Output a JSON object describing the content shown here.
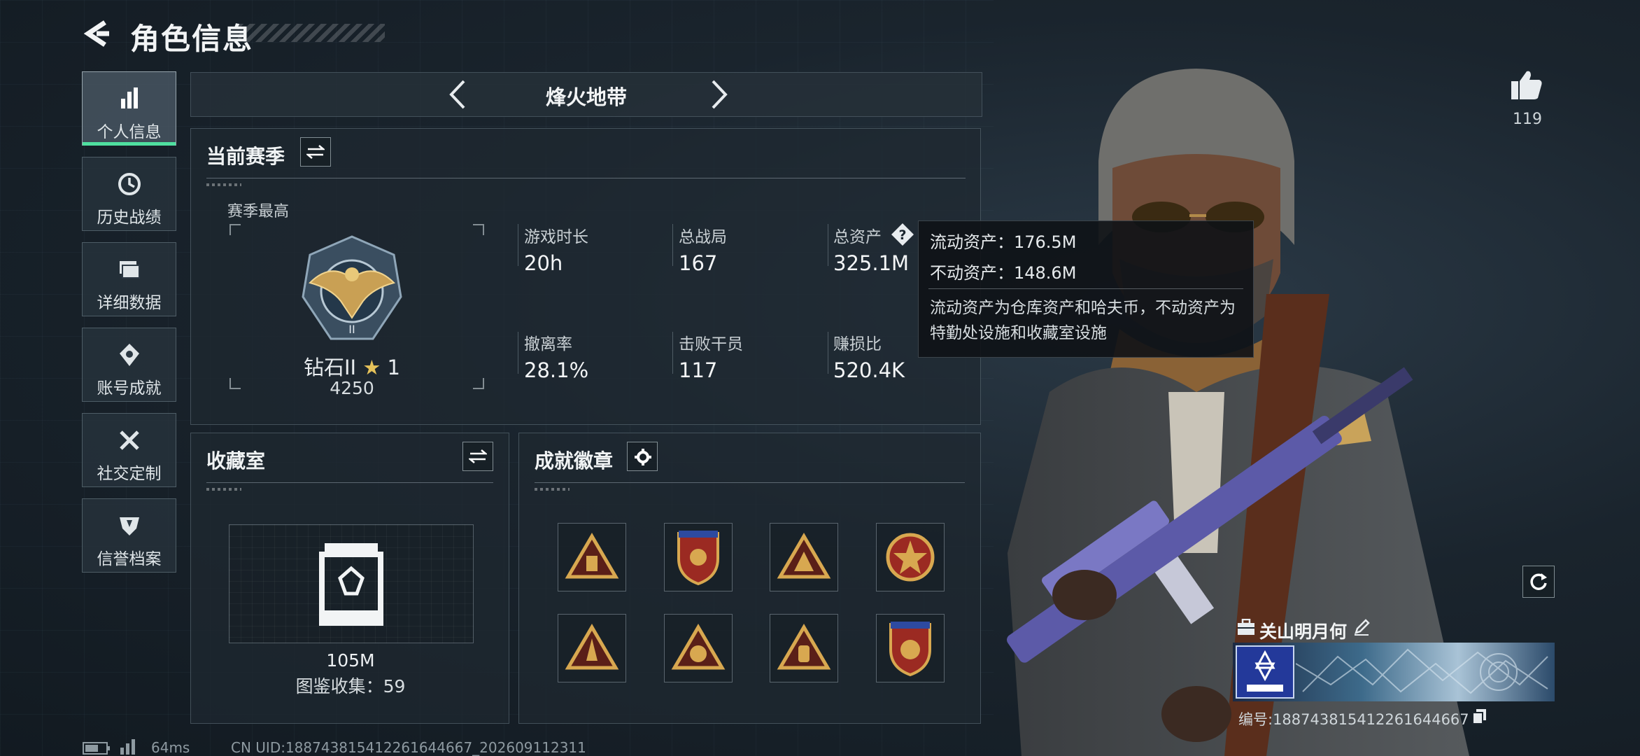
{
  "header": {
    "title": "角色信息"
  },
  "sidebar": {
    "items": [
      {
        "label": "个人信息",
        "icon": "bar-chart-icon",
        "active": true
      },
      {
        "label": "历史战绩",
        "icon": "history-icon",
        "active": false
      },
      {
        "label": "详细数据",
        "icon": "folder-icon",
        "active": false
      },
      {
        "label": "账号成就",
        "icon": "achievement-icon",
        "active": false
      },
      {
        "label": "社交定制",
        "icon": "tools-icon",
        "active": false
      },
      {
        "label": "信誉档案",
        "icon": "shield-icon",
        "active": false
      }
    ]
  },
  "mode": {
    "name": "烽火地带"
  },
  "season": {
    "title": "当前赛季",
    "best_label": "赛季最高",
    "rank_name": "钻石II",
    "rank_stars": "1",
    "rank_score": "4250",
    "stats": [
      {
        "label": "游戏时长",
        "value": "20h"
      },
      {
        "label": "总战局",
        "value": "167"
      },
      {
        "label": "总资产",
        "value": "325.1M"
      },
      {
        "label": "撤离率",
        "value": "28.1%"
      },
      {
        "label": "击败干员",
        "value": "117"
      },
      {
        "label": "赚损比",
        "value": "520.4K"
      }
    ]
  },
  "tooltip": {
    "liquid": "流动资产：176.5M",
    "fixed": "不动资产：148.6M",
    "note": "流动资产为仓库资产和哈夫币，不动资产为特勤处设施和收藏室设施"
  },
  "collection": {
    "title": "收藏室",
    "value": "105M",
    "catalog": "图鉴收集：59"
  },
  "achievements": {
    "title": "成就徽章",
    "badges": [
      "triangle-badge",
      "shield-badge",
      "triangle-badge",
      "star-badge",
      "triangle-badge",
      "triangle-badge",
      "triangle-badge",
      "shield-badge"
    ]
  },
  "profile": {
    "likes": "119",
    "name": "关山明月何",
    "id_text": "编号:188743815412261644667"
  },
  "status_bar": {
    "ping": "64ms",
    "uid": "CN UID:188743815412261644667_202609112311"
  },
  "colors": {
    "accent": "#4fe0a0",
    "gold": "#d8a850",
    "panel_border": "#8ca0ac"
  }
}
